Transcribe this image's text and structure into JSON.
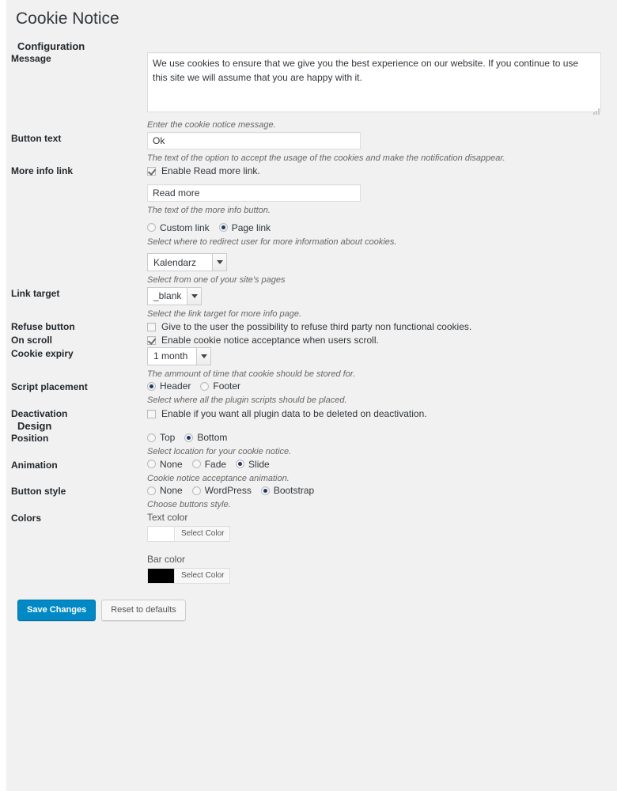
{
  "page": {
    "title": "Cookie Notice"
  },
  "sections": {
    "configuration": "Configuration",
    "design": "Design"
  },
  "fields": {
    "message": {
      "label": "Message",
      "value": "We use cookies to ensure that we give you the best experience on our website. If you continue to use this site we will assume that you are happy with it.",
      "description": "Enter the cookie notice message."
    },
    "button_text": {
      "label": "Button text",
      "value": "Ok",
      "description": "The text of the option to accept the usage of the cookies and make the notification disappear."
    },
    "more_info_link": {
      "label": "More info link",
      "enable_label": "Enable Read more link.",
      "enable_checked": true,
      "value": "Read more",
      "description": "The text of the more info button.",
      "link_type_options": [
        "Custom link",
        "Page link"
      ],
      "link_type_selected": "Page link",
      "link_type_description": "Select where to redirect user for more information about cookies.",
      "page_select_value": "Kalendarz",
      "page_select_description": "Select from one of your site's pages"
    },
    "link_target": {
      "label": "Link target",
      "value": "_blank",
      "description": "Select the link target for more info page."
    },
    "refuse_button": {
      "label": "Refuse button",
      "checkbox_label": "Give to the user the possibility to refuse third party non functional cookies.",
      "checked": false
    },
    "on_scroll": {
      "label": "On scroll",
      "checkbox_label": "Enable cookie notice acceptance when users scroll.",
      "checked": true
    },
    "cookie_expiry": {
      "label": "Cookie expiry",
      "value": "1 month",
      "description": "The ammount of time that cookie should be stored for."
    },
    "script_placement": {
      "label": "Script placement",
      "options": [
        "Header",
        "Footer"
      ],
      "selected": "Header",
      "description": "Select where all the plugin scripts should be placed."
    },
    "deactivation": {
      "label": "Deactivation",
      "checkbox_label": "Enable if you want all plugin data to be deleted on deactivation.",
      "checked": false
    },
    "position": {
      "label": "Position",
      "options": [
        "Top",
        "Bottom"
      ],
      "selected": "Bottom",
      "description": "Select location for your cookie notice."
    },
    "animation": {
      "label": "Animation",
      "options": [
        "None",
        "Fade",
        "Slide"
      ],
      "selected": "Slide",
      "description": "Cookie notice acceptance animation."
    },
    "button_style": {
      "label": "Button style",
      "options": [
        "None",
        "WordPress",
        "Bootstrap"
      ],
      "selected": "Bootstrap",
      "description": "Choose buttons style."
    },
    "colors": {
      "label": "Colors",
      "text_color_label": "Text color",
      "text_color_value": "#ffffff",
      "text_color_button": "Select Color",
      "bar_color_label": "Bar color",
      "bar_color_value": "#000000",
      "bar_color_button": "Select Color"
    }
  },
  "footer": {
    "save_label": "Save Changes",
    "reset_label": "Reset to defaults"
  },
  "theme": {
    "accent": "#0089c4",
    "page_bg": "#f1f1f1",
    "radio_dot": "#1b3a66"
  }
}
